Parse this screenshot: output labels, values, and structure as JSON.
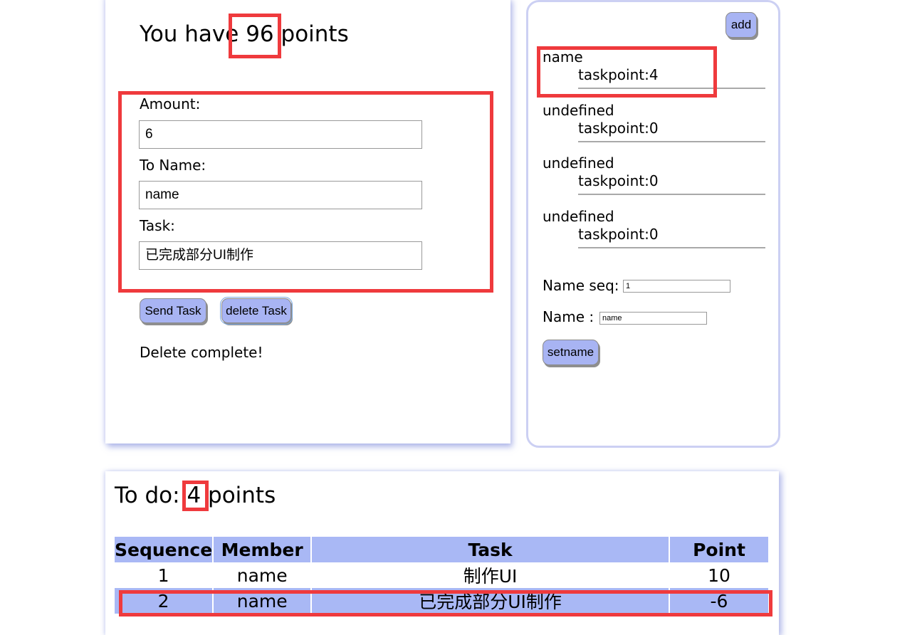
{
  "points": {
    "prefix": "You have ",
    "value": "96",
    "suffix": " points"
  },
  "form": {
    "amount_label": "Amount:",
    "amount_value": "6",
    "to_name_label": "To Name:",
    "to_name_value": "name",
    "task_label": "Task:",
    "task_value": "已完成部分UI制作",
    "send_button": "Send Task",
    "delete_button": "delete Task",
    "status": "Delete complete!"
  },
  "members_panel": {
    "add_button": "add",
    "members": [
      {
        "name": "name",
        "taskpoint": "taskpoint:4"
      },
      {
        "name": "undefined",
        "taskpoint": "taskpoint:0"
      },
      {
        "name": "undefined",
        "taskpoint": "taskpoint:0"
      },
      {
        "name": "undefined",
        "taskpoint": "taskpoint:0"
      }
    ],
    "name_seq_label": "Name seq:",
    "name_seq_value": "1",
    "name_label": "Name :",
    "name_value": "name",
    "setname_button": "setname"
  },
  "todo": {
    "prefix": "To do: ",
    "value": "4",
    "suffix": " points",
    "columns": [
      "Sequence",
      "Member",
      "Task",
      "Point"
    ],
    "rows": [
      {
        "sequence": "1",
        "member": "name",
        "task": "制作UI",
        "point": "10"
      },
      {
        "sequence": "2",
        "member": "name",
        "task": "已完成部分UI制作",
        "point": "-6"
      }
    ]
  },
  "colors": {
    "accent": "#a9b8f5",
    "highlight": "#ef3a3d",
    "panel_border": "#ccd0f3"
  }
}
